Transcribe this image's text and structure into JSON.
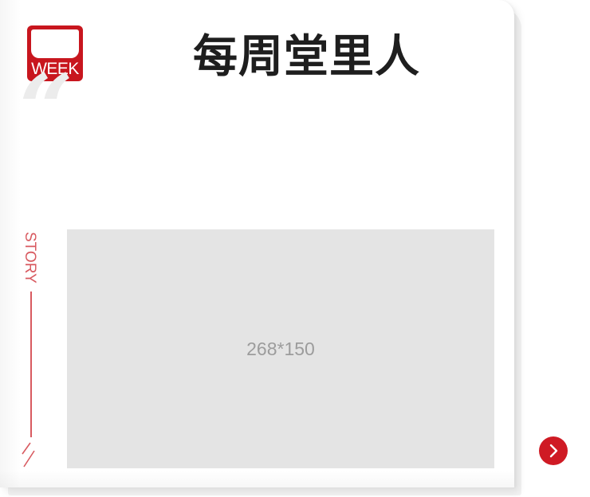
{
  "logo": {
    "text": "WEEK"
  },
  "header": {
    "title": "每周堂里人"
  },
  "decor": {
    "quote_glyph": "“"
  },
  "sidebar": {
    "story_label": "STORY"
  },
  "image": {
    "placeholder_text": "268*150"
  },
  "navigation": {
    "next_icon": "chevron-right-icon"
  },
  "colors": {
    "brand_red": "#c8161e",
    "accent_pink": "#d85a60",
    "title_text": "#1e1e1e",
    "placeholder_bg": "#e4e4e4",
    "placeholder_text": "#9c9c9c"
  }
}
